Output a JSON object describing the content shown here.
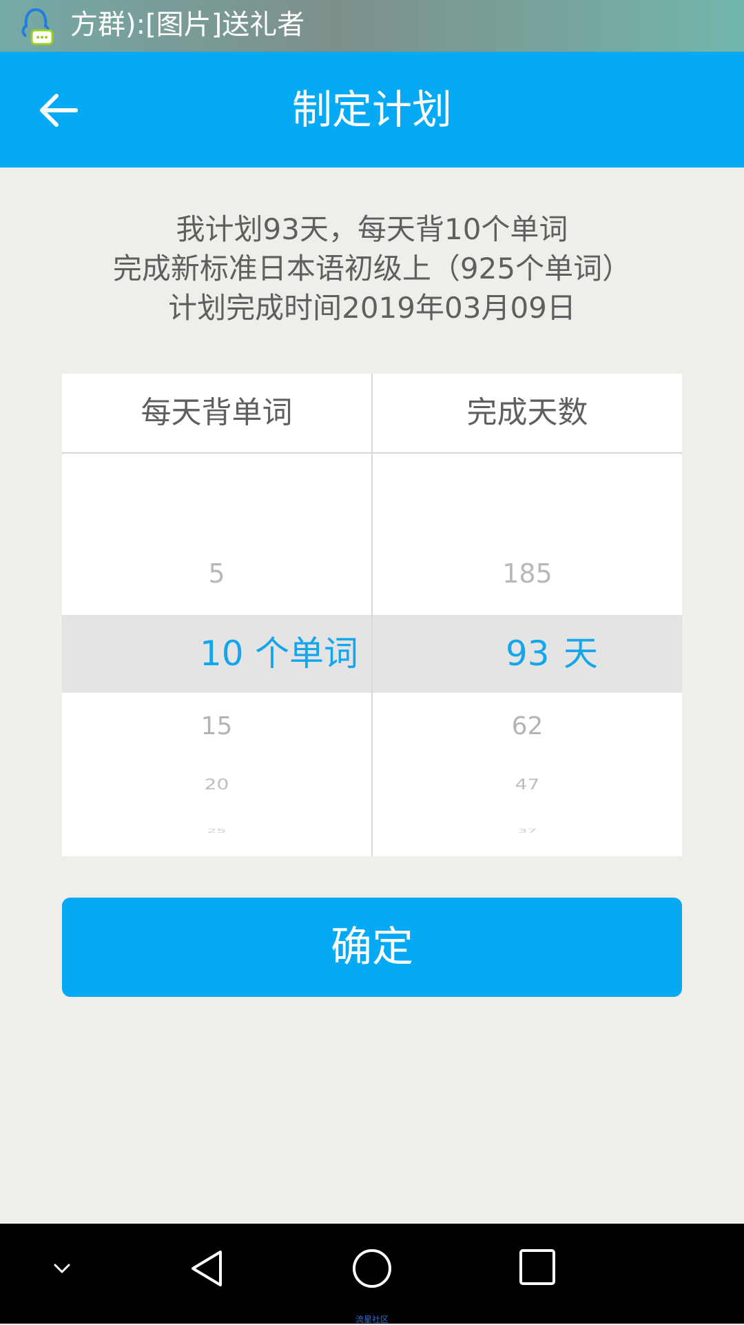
{
  "status_bar": {
    "notification_icon": "qq-chat-icon",
    "notification_text": "方群):[图片]送礼者"
  },
  "app_bar": {
    "back_icon": "arrow-left-icon",
    "title": "制定计划"
  },
  "summary": {
    "line1": "我计划93天，每天背10个单词",
    "line2": "完成新标准日本语初级上（925个单词）",
    "line3": "计划完成时间2019年03月09日"
  },
  "picker": {
    "words_column": {
      "header": "每天背单词",
      "items": [
        "5",
        "10",
        "15",
        "20",
        "25"
      ],
      "selected_value": "10",
      "unit": "个单词"
    },
    "days_column": {
      "header": "完成天数",
      "items": [
        "185",
        "93",
        "62",
        "47",
        "37"
      ],
      "selected_value": "93",
      "unit": "天"
    }
  },
  "confirm_button": {
    "label": "确定"
  },
  "nav_bar": {
    "icons": [
      "chevron-down-icon",
      "back-triangle-icon",
      "home-circle-icon",
      "recents-square-icon"
    ],
    "watermark": "流星社区"
  },
  "colors": {
    "accent": "#06a9f4",
    "selected_text": "#14a6ec",
    "background": "#f0eeeb"
  }
}
